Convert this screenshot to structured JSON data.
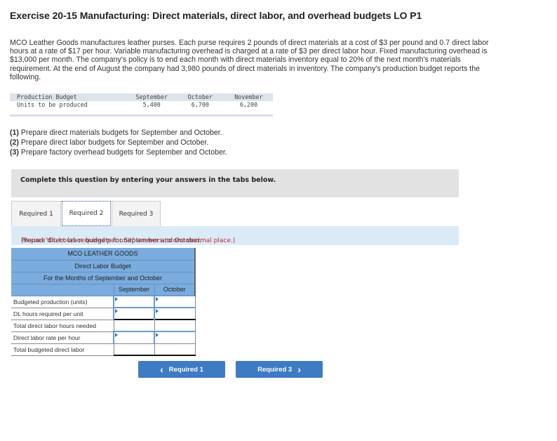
{
  "title": "Exercise 20-15 Manufacturing: Direct materials, direct labor, and overhead budgets LO P1",
  "intro": "MCO Leather Goods manufactures leather purses. Each purse requires 2 pounds of direct materials at a cost of $3 per pound and 0.7 direct labor hours at a rate of $17 per hour. Variable manufacturing overhead is charged at a rate of $3 per direct labor hour. Fixed manufacturing overhead is $13,000 per month. The company's policy is to end each month with direct materials inventory equal to 20% of the next month's materials requirement. At the end of August the company had 3,980 pounds of direct materials in inventory. The company's production budget reports the following.",
  "production_budget": {
    "header": [
      "Production Budget",
      "September",
      "October",
      "November"
    ],
    "row": [
      "Units to be produced",
      "5,400",
      "6,700",
      "6,200"
    ]
  },
  "requirements": [
    {
      "num": "(1)",
      "text": " Prepare direct materials budgets for September and October."
    },
    {
      "num": "(2)",
      "text": " Prepare direct labor budgets for September and October."
    },
    {
      "num": "(3)",
      "text": " Prepare factory overhead budgets for September and October."
    }
  ],
  "complete_text": "Complete this question by entering your answers in the tabs below.",
  "tabs": [
    {
      "label": "Required 1",
      "active": false
    },
    {
      "label": "Required 2",
      "active": true
    },
    {
      "label": "Required 3",
      "active": false
    }
  ],
  "instruction": {
    "text": "Prepare direct labor budgets for September and October. ",
    "note": "(Round \"DL hours required per unit\" answers to one decimal place.)"
  },
  "budget": {
    "company": "MCO LEATHER GOODS",
    "name": "Direct Labor Budget",
    "period": "For the Months of September and October",
    "columns": [
      "September",
      "October"
    ],
    "rows": [
      {
        "label": "Budgeted production (units)",
        "september": "",
        "october": ""
      },
      {
        "label": "DL hours required per unit",
        "september": "",
        "october": ""
      },
      {
        "label": "Total direct labor hours needed",
        "september": "",
        "october": ""
      },
      {
        "label": "Direct labor rate per hour",
        "september": "",
        "october": ""
      },
      {
        "label": "Total budgeted direct labor",
        "september": "",
        "october": ""
      }
    ]
  },
  "nav": {
    "prev_label": "Required 1",
    "next_label": "Required 3",
    "prev_icon": "‹",
    "next_icon": "›"
  },
  "colors": {
    "header_blue": "#7aacdf",
    "button_blue": "#3f7bc4",
    "note_red": "#c0282d",
    "instruction_band": "#dbeaf7"
  }
}
